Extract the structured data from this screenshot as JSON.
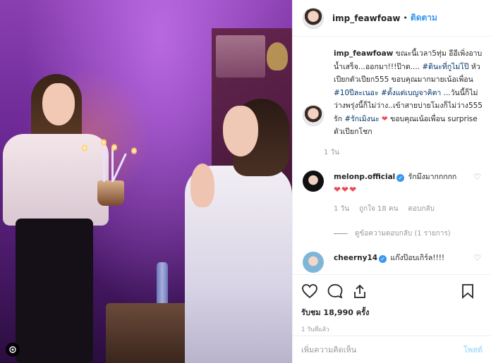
{
  "post": {
    "username": "imp_feawfoaw",
    "follow_label": "ติดตาม",
    "caption_parts": {
      "username": "imp_feawfoaw",
      "text1": " ขณะนี้เวลา5ทุ่ม อีอีเพิ่งอาบน้ำเสร็จ...ออกมา!!!ป๊าด.... ",
      "tag1": "#ดินะที่กูไม่โป๊",
      "text2": " หัวเปียกตัวเปียก555 ขอบคุณมากมายเน้อเพื่อน ",
      "tag2": "#10ปีละเนอะ",
      "text3": " ",
      "tag3": "#ตั้งแต่เบญจาคิตา",
      "text4": " ...วันนี้ก็ไม่ว่างพรุ่งนี้ก็ไม่ว่าง..เข้าสายบ่ายโมงก็ไม่ว่าง555 รัก ",
      "tag4": "#รักเมิงนะ",
      "text5": " ขอบคุณเน้อเพื่อน surprise ตัวเปียกโชก"
    },
    "caption_age": "1 วัน",
    "comments": [
      {
        "username": "melonp.official",
        "text": " รักมึงมากกกกก",
        "hearts": "❤❤❤",
        "age": "1 วัน",
        "likes": "ถูกใจ 18 คน",
        "reply": "ตอบกลับ",
        "view_replies": "ดูข้อความตอบกลับ (1 รายการ)"
      },
      {
        "username": "cheerny14",
        "text": " แก๊งป๊อบเกิร์ล!!!!"
      }
    ],
    "likes_count": "รับชม 18,990 ครั้ง",
    "posted_time": "1 วันที่แล้ว",
    "add_comment_placeholder": "เพิ่มความคิดเห็น",
    "post_button": "โพสต์"
  },
  "colors": {
    "accent": "#3897f0",
    "heart": "#ed4956",
    "muted": "#999999"
  },
  "icons": [
    "heart-icon",
    "comment-icon",
    "share-icon",
    "bookmark-icon",
    "video-icon",
    "verified-icon"
  ]
}
